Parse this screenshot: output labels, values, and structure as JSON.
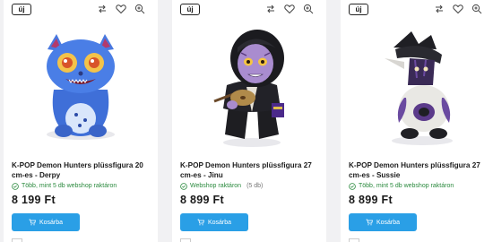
{
  "products": [
    {
      "badge": "új",
      "title": "K-POP Demon Hunters plüssfigura 20 cm-es - Derpy",
      "stock": "Több, mint 5 db webshop raktáron",
      "stock_count": "",
      "price": "8 199 Ft",
      "cart_label": "Kosárba"
    },
    {
      "badge": "új",
      "title": "K-POP Demon Hunters plüssfigura 27 cm-es - Jinu",
      "stock": "Webshop raktáron",
      "stock_count": "(5 db)",
      "price": "8 899 Ft",
      "cart_label": "Kosárba"
    },
    {
      "badge": "új",
      "title": "K-POP Demon Hunters plüssfigura 27 cm-es - Sussie",
      "stock": "Több, mint 5 db webshop raktáron",
      "stock_count": "",
      "price": "8 899 Ft",
      "cart_label": "Kosárba"
    }
  ],
  "icons": {
    "compare": "compare-arrows-icon",
    "wishlist": "heart-icon",
    "zoom": "zoom-in-icon",
    "stock": "check-circle-icon",
    "cart": "cart-icon"
  },
  "colors": {
    "cart_button": "#2a9fe6",
    "stock_green": "#2b8a3e",
    "page_bg": "#f1f1f3"
  }
}
